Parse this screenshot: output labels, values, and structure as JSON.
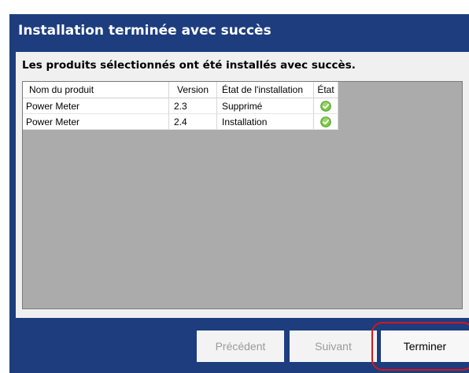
{
  "window": {
    "title": "Installation terminée avec succès",
    "subtitle": "Les produits sélectionnés ont été installés avec succès."
  },
  "table": {
    "columns": [
      "Nom du produit",
      "Version",
      "État de l'installation",
      "État"
    ],
    "rows": [
      {
        "product": "Power Meter",
        "version": "2.3",
        "install_state": "Supprimé",
        "status_icon": "success-check-icon"
      },
      {
        "product": "Power Meter",
        "version": "2.4",
        "install_state": "Installation",
        "status_icon": "success-check-icon"
      }
    ]
  },
  "buttons": {
    "previous": "Précédent",
    "next": "Suivant",
    "finish": "Terminer"
  },
  "colors": {
    "title_bar": "#1d3d7e",
    "grid_empty_area": "#ababab",
    "success_icon": "#6cbf3f",
    "highlight": "#d4161e"
  }
}
